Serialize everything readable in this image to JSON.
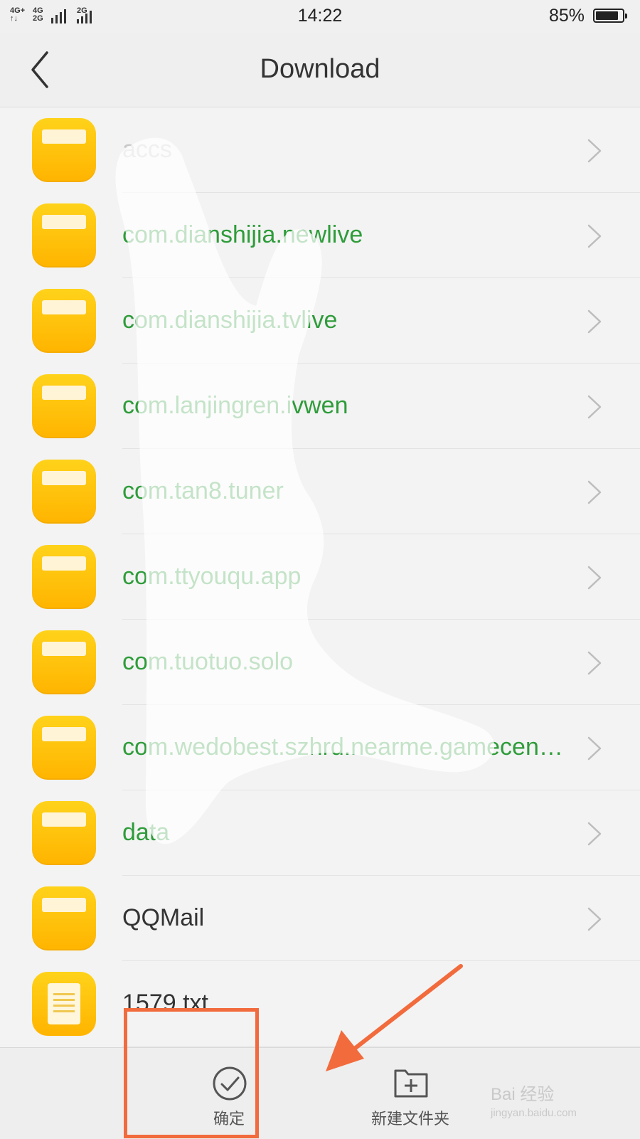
{
  "status_bar": {
    "signal_1_top": "4G+",
    "signal_1_bottom": "↑↓",
    "signal_2_top": "4G",
    "signal_2_bottom": "2G",
    "signal_3_top": "2G",
    "time": "14:22",
    "battery_text": "85%",
    "battery_level": 0.85
  },
  "header": {
    "title": "Download",
    "back_icon": "chevron-left-icon"
  },
  "files": [
    {
      "name": "accs",
      "type": "folder",
      "style": "light"
    },
    {
      "name": "com.dianshijia.newlive",
      "type": "folder",
      "style": "green"
    },
    {
      "name": "com.dianshijia.tvlive",
      "type": "folder",
      "style": "green"
    },
    {
      "name": "com.lanjingren.ivwen",
      "type": "folder",
      "style": "green"
    },
    {
      "name": "com.tan8.tuner",
      "type": "folder",
      "style": "green"
    },
    {
      "name": "com.ttyouqu.app",
      "type": "folder",
      "style": "green"
    },
    {
      "name": "com.tuotuo.solo",
      "type": "folder",
      "style": "green"
    },
    {
      "name": "com.wedobest.szhrd.nearme.gamecenter",
      "type": "folder",
      "style": "green"
    },
    {
      "name": "data",
      "type": "folder",
      "style": "green"
    },
    {
      "name": "QQMail",
      "type": "folder",
      "style": "dark"
    },
    {
      "name": "1579.txt",
      "type": "file",
      "style": "dark"
    }
  ],
  "toolbar": {
    "confirm_label": "确定",
    "confirm_icon": "check-circle-icon",
    "new_folder_label": "新建文件夹",
    "new_folder_icon": "folder-plus-icon"
  },
  "watermark": {
    "brand": "Bai 经验",
    "url": "jingyan.baidu.com"
  },
  "colors": {
    "folder_yellow": "#ffc20e",
    "accent_green": "#2e9c3a",
    "annotation_orange": "#f26b3c"
  }
}
